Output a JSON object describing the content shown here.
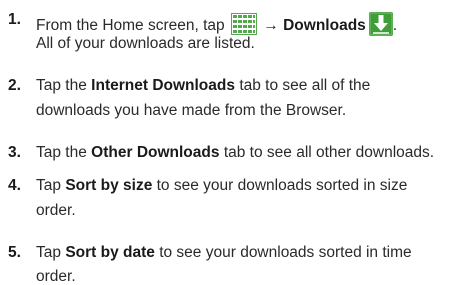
{
  "steps": [
    {
      "number": "1.",
      "line1_prefix": "From the Home screen, tap",
      "arrow": "→",
      "line1_bold": "Downloads",
      "line1_suffix": ".",
      "line2": "All of your downloads are listed.",
      "icons": [
        "apps-grid-icon",
        "download-arrow-icon"
      ]
    },
    {
      "number": "2.",
      "pre": "Tap the",
      "bold": "Internet Downloads",
      "post": "tab to see all of the",
      "line2": "downloads you have made from the Browser."
    },
    {
      "number": "3.",
      "pre": "Tap the",
      "bold": "Other Downloads",
      "post": "tab to see all other downloads."
    },
    {
      "number": "4.",
      "pre": "Tap",
      "bold": "Sort by size",
      "post": "to see your downloads sorted in size",
      "line2": "order."
    },
    {
      "number": "5.",
      "pre": "Tap",
      "bold": "Sort by date",
      "post": "to see your downloads sorted in time",
      "line2": "order."
    }
  ],
  "colors": {
    "grid_icon": "#56a84f",
    "download_icon_bg": "#3f9d3a",
    "text": "#2a2a2a"
  }
}
